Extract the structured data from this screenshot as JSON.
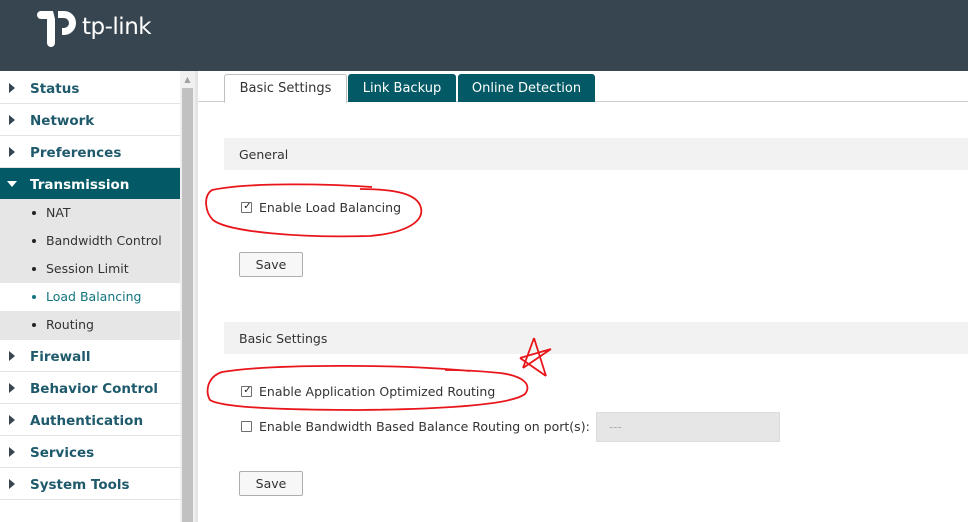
{
  "header": {
    "logo_text": "tp-link"
  },
  "sidebar": {
    "items": [
      {
        "label": "Status"
      },
      {
        "label": "Network"
      },
      {
        "label": "Preferences"
      },
      {
        "label": "Transmission"
      },
      {
        "label": "Firewall"
      },
      {
        "label": "Behavior Control"
      },
      {
        "label": "Authentication"
      },
      {
        "label": "Services"
      },
      {
        "label": "System Tools"
      }
    ],
    "sub_items": [
      {
        "label": "NAT"
      },
      {
        "label": "Bandwidth Control"
      },
      {
        "label": "Session Limit"
      },
      {
        "label": "Load Balancing"
      },
      {
        "label": "Routing"
      }
    ]
  },
  "tabs": [
    {
      "label": "Basic Settings"
    },
    {
      "label": "Link Backup"
    },
    {
      "label": "Online Detection"
    }
  ],
  "general": {
    "title": "General",
    "enable_load_balancing": {
      "label": "Enable Load Balancing",
      "checked": true
    },
    "save_label": "Save"
  },
  "basic_settings": {
    "title": "Basic Settings",
    "enable_app_routing": {
      "label": "Enable Application Optimized Routing",
      "checked": true
    },
    "enable_bandwidth_routing": {
      "label": "Enable Bandwidth Based Balance Routing on port(s):",
      "checked": false
    },
    "port_value": "---",
    "save_label": "Save"
  },
  "colors": {
    "header_bg": "#36454f",
    "accent": "#035a66",
    "annotation_red": "#e8161b"
  }
}
